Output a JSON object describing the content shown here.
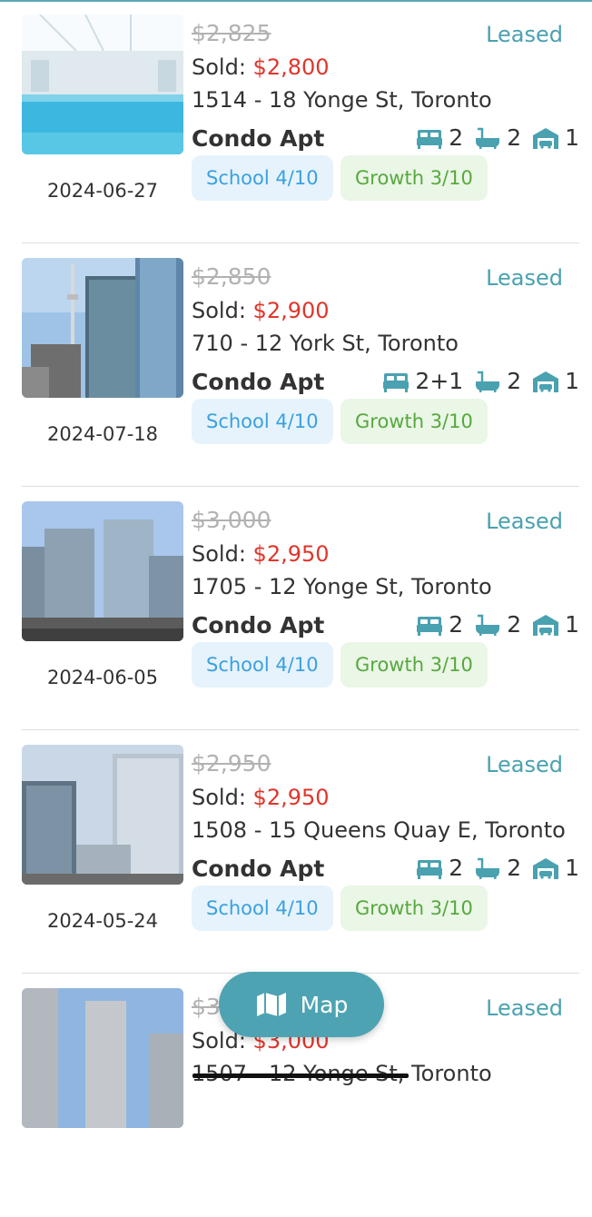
{
  "colors": {
    "accent": "#4ea3b2",
    "status_leased": "#4aa1b0",
    "sold_price": "#e0352b",
    "school_text": "#3ba0e0",
    "growth_text": "#57a83f"
  },
  "icons": {
    "bed": "bed-icon",
    "bath": "bath-icon",
    "parking": "garage-icon",
    "map": "map-icon"
  },
  "listings": [
    {
      "original_price": "$2,825",
      "status": "Leased",
      "sold_label": "Sold:",
      "sold_price": "$2,800",
      "address": "1514 - 18 Yonge St, Toronto",
      "type": "Condo Apt",
      "beds": "2",
      "baths": "2",
      "parking": "1",
      "date": "2024-06-27",
      "school": "School 4/10",
      "growth": "Growth 3/10"
    },
    {
      "original_price": "$2,850",
      "status": "Leased",
      "sold_label": "Sold:",
      "sold_price": "$2,900",
      "address": "710 - 12 York St, Toronto",
      "type": "Condo Apt",
      "beds": "2+1",
      "baths": "2",
      "parking": "1",
      "date": "2024-07-18",
      "school": "School 4/10",
      "growth": "Growth 3/10"
    },
    {
      "original_price": "$3,000",
      "status": "Leased",
      "sold_label": "Sold:",
      "sold_price": "$2,950",
      "address": "1705 - 12 Yonge St, Toronto",
      "type": "Condo Apt",
      "beds": "2",
      "baths": "2",
      "parking": "1",
      "date": "2024-06-05",
      "school": "School 4/10",
      "growth": "Growth 3/10"
    },
    {
      "original_price": "$2,950",
      "status": "Leased",
      "sold_label": "Sold:",
      "sold_price": "$2,950",
      "address": "1508 - 15 Queens Quay E, Toronto",
      "type": "Condo Apt",
      "beds": "2",
      "baths": "2",
      "parking": "1",
      "date": "2024-05-24",
      "school": "School 4/10",
      "growth": "Growth 3/10"
    },
    {
      "original_price": "$3",
      "status": "Leased",
      "sold_label": "Sold:",
      "sold_price": "$3,000",
      "address": "1507 - 12 Yonge St, Toronto"
    }
  ],
  "map_button": {
    "label": "Map"
  }
}
